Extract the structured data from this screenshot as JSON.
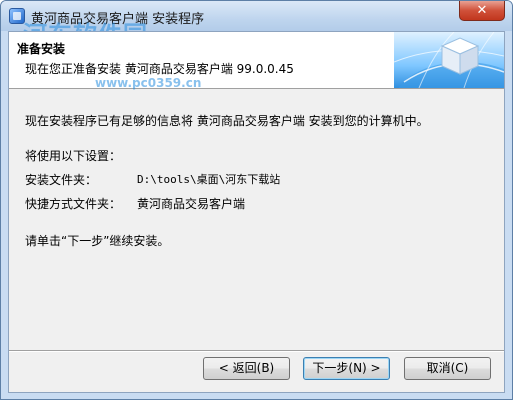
{
  "window": {
    "title": "黄河商品交易客户端 安装程序",
    "close_glyph": "✕"
  },
  "watermark": {
    "text": "河东软件园",
    "url": "www.pc0359.cn"
  },
  "header": {
    "title": "准备安装",
    "subtitle": "现在您正准备安装 黄河商品交易客户端 99.0.0.45"
  },
  "body": {
    "intro": "现在安装程序已有足够的信息将 黄河商品交易客户端 安装到您的计算机中。",
    "settings_heading": "将使用以下设置：",
    "install_folder_label": "安装文件夹：",
    "install_folder_value": "D:\\tools\\桌面\\河东下载站",
    "shortcut_folder_label": "快捷方式文件夹：",
    "shortcut_folder_value": "黄河商品交易客户端",
    "continue_hint": "请单击“下一步”继续安装。"
  },
  "buttons": {
    "back": "< 返回(B)",
    "next": "下一步(N) >",
    "cancel": "取消(C)"
  }
}
